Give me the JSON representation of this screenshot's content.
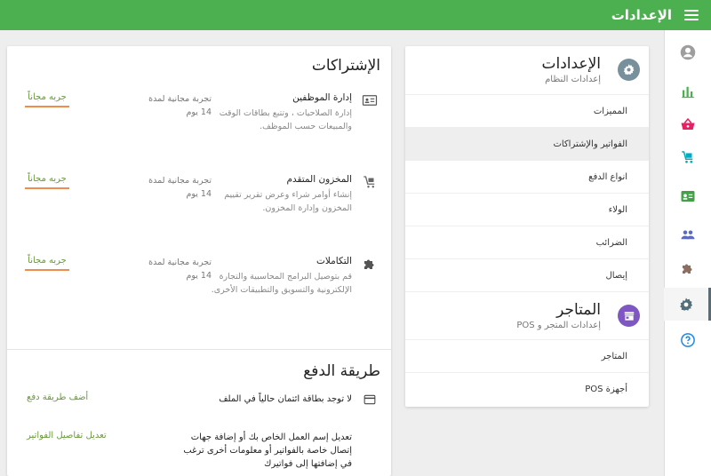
{
  "topbar": {
    "title": "الإعدادات",
    "color": "#4caf50"
  },
  "rail": {
    "items": [
      {
        "icon": "user-circle-icon"
      },
      {
        "icon": "bar-chart-icon"
      },
      {
        "icon": "basket-icon"
      },
      {
        "icon": "cart-icon"
      },
      {
        "icon": "id-card-icon"
      },
      {
        "icon": "people-icon"
      },
      {
        "icon": "puzzle-icon"
      },
      {
        "icon": "gear-icon",
        "active": true
      },
      {
        "icon": "help-icon"
      }
    ]
  },
  "settings": {
    "system": {
      "title": "الإعدادات",
      "subtitle": "إعدادات النظام",
      "icon": "gear-icon",
      "items": [
        "المميزات",
        "الفواتير والإشتراكات",
        "انواع الدفع",
        "الولاء",
        "الضرائب",
        "إيصال"
      ]
    },
    "stores": {
      "title": "المتاجر",
      "subtitle": "إعدادات المتجر و POS",
      "icon": "store-icon",
      "items": [
        "المتاجر",
        "أجهزة POS"
      ]
    },
    "active_item": "الفواتير والإشتراكات"
  },
  "subscriptions": {
    "title": "الإشتراكات",
    "items": [
      {
        "icon": "id-card-icon",
        "name": "إدارة الموظفين",
        "desc": "إدارة الصلاحيات ، وتتبع بطاقات الوقت والمبيعات حسب الموظف.",
        "trial": "تجربة مجانية لمدة 14 يوم",
        "button": "جربه مجاناً"
      },
      {
        "icon": "cart-icon",
        "name": "المخزون المتقدم",
        "desc": "إنشاء أوامر شراء وعرض تقرير تقييم المخزون وإدارة المخزون.",
        "trial": "تجربة مجانية لمدة 14 يوم",
        "button": "جربه مجاناً"
      },
      {
        "icon": "puzzle-icon",
        "name": "التكاملات",
        "desc": "قم بتوصيل البرامج المحاسبية والتجارة الإلكترونية والتسويق والتطبيقات الأخرى.",
        "trial": "تجربة مجانية لمدة 14 يوم",
        "button": "جربه مجاناً"
      }
    ]
  },
  "payment": {
    "title": "طريقة الدفع",
    "card_text": "لا توجد بطاقة ائتمان حالياً في الملف",
    "add_link": "أضف طريقة دفع",
    "billing_text": "تعديل إسم العمل الخاص بك أو إضافة جهات إتصال خاصة بالفواتير أو معلومات أخرى ترغب في إضافتها إلى فواتيرك",
    "edit_link": "تعديل تفاصيل الفواتير"
  }
}
